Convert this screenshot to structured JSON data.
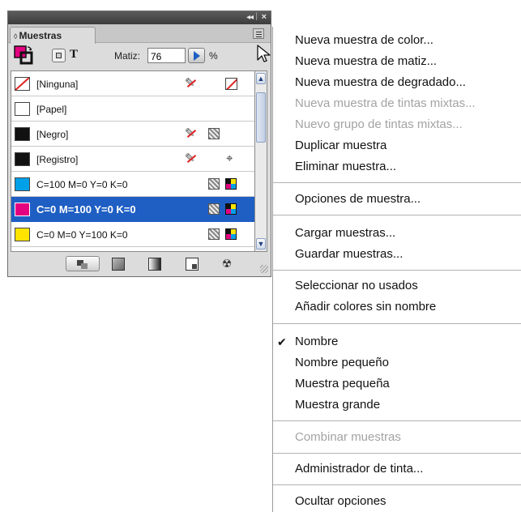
{
  "panel": {
    "tab_label": "Muestras",
    "tab_glyph": "◊",
    "titlebar": {
      "collapse_glyph": "◂◂",
      "separator": "|",
      "close_glyph": "×"
    },
    "tint": {
      "label": "Matiz:",
      "value": "76",
      "unit": "%"
    },
    "text_mode_glyph": "T",
    "icons": {
      "fill_stroke": "fill-stroke-icon",
      "formatting": "formatting-affects-container-icon",
      "text": "text-T-icon",
      "non_editable": "pencil-crossed-icon",
      "process": "process-color-icon",
      "cmyk": "cmyk-mode-icon",
      "registration": "registration-target-icon"
    },
    "swatches": [
      {
        "name": "[Ninguna]",
        "chip": "none",
        "nonedit": true,
        "mode": "none"
      },
      {
        "name": "[Papel]",
        "chip": "#ffffff",
        "nonedit": false,
        "mode": ""
      },
      {
        "name": "[Negro]",
        "chip": "#111111",
        "nonedit": true,
        "mode": "process"
      },
      {
        "name": "[Registro]",
        "chip": "#111111",
        "nonedit": true,
        "mode": "registration"
      },
      {
        "name": "C=100 M=0 Y=0 K=0",
        "chip": "#00a0e9",
        "nonedit": false,
        "mode": "cmyk"
      },
      {
        "name": "C=0 M=100 Y=0 K=0",
        "chip": "#e4007f",
        "nonedit": false,
        "mode": "cmyk",
        "selected": true
      },
      {
        "name": "C=0 M=0 Y=100 K=0",
        "chip": "#ffe400",
        "nonedit": false,
        "mode": "cmyk"
      }
    ],
    "scroll_glyphs": {
      "up": "▲",
      "down": "▼"
    },
    "delete_glyph": "☢",
    "registration_glyph": "⌖",
    "pencil_glyph": "✎",
    "colors": {
      "selection": "#1f5fc4",
      "cyan": "#00a0e9",
      "magenta": "#e4007f",
      "yellow": "#ffe400",
      "black": "#111111"
    }
  },
  "menu": {
    "check_glyph": "✔",
    "items": [
      {
        "label": "Nueva muestra de color...",
        "enabled": true
      },
      {
        "label": "Nueva muestra de matiz...",
        "enabled": true
      },
      {
        "label": "Nueva muestra de degradado...",
        "enabled": true
      },
      {
        "label": "Nueva muestra de tintas mixtas...",
        "enabled": false
      },
      {
        "label": "Nuevo grupo de tintas mixtas...",
        "enabled": false
      },
      {
        "label": "Duplicar muestra",
        "enabled": true
      },
      {
        "label": "Eliminar muestra...",
        "enabled": true
      },
      {
        "label": "Opciones de muestra...",
        "enabled": true
      },
      {
        "label": "Cargar muestras...",
        "enabled": true
      },
      {
        "label": "Guardar muestras...",
        "enabled": true
      },
      {
        "label": "Seleccionar no usados",
        "enabled": true
      },
      {
        "label": "Añadir colores sin nombre",
        "enabled": true
      },
      {
        "label": "Nombre",
        "enabled": true,
        "checked": true
      },
      {
        "label": "Nombre pequeño",
        "enabled": true
      },
      {
        "label": "Muestra pequeña",
        "enabled": true
      },
      {
        "label": "Muestra grande",
        "enabled": true
      },
      {
        "label": "Combinar muestras",
        "enabled": false
      },
      {
        "label": "Administrador de tinta...",
        "enabled": true
      },
      {
        "label": "Ocultar opciones",
        "enabled": true
      }
    ]
  }
}
